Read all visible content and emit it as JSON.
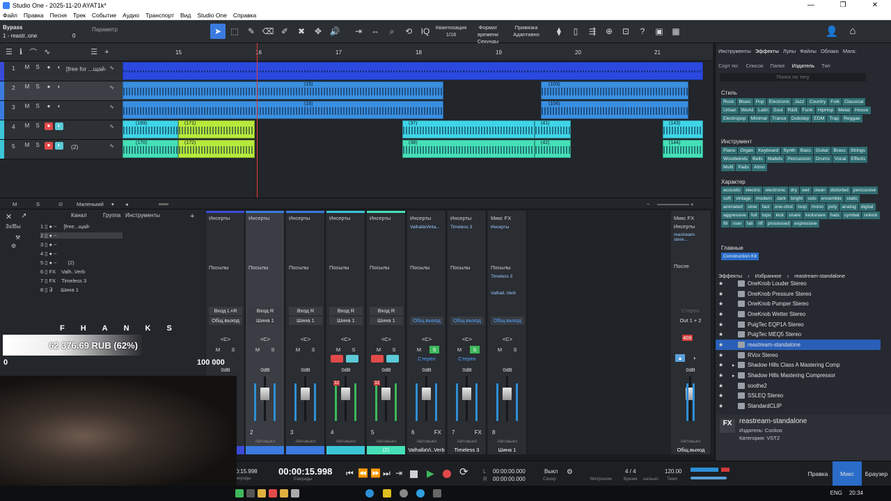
{
  "titlebar": {
    "title": "Studio One - 2025-11-20 AYAT1k*"
  },
  "menu": [
    "Файл",
    "Правка",
    "Песня",
    "Трек",
    "Событие",
    "Аудио",
    "Транспорт",
    "Вид",
    "Studio One",
    "Справка"
  ],
  "toolbar": {
    "bypass": "Bypass",
    "track": "1 - reastr..one",
    "param": "Параметр",
    "zero": "0",
    "quant_label": "Квантизация",
    "quant_value": "1/16",
    "timefmt_label": "Формат времени",
    "timefmt_value": "Секунды",
    "snap_label": "Привязка",
    "snap_value": "Адаптивно"
  },
  "ruler": [
    "15",
    "16",
    "17",
    "18",
    "19",
    "20",
    "21"
  ],
  "tracks": [
    {
      "num": "1",
      "name": "[free for ...щай-",
      "color": "#3a4bd8"
    },
    {
      "num": "2",
      "name": "",
      "color": "#3b7be0"
    },
    {
      "num": "3",
      "name": "",
      "color": "#3b7be0"
    },
    {
      "num": "4",
      "name": "",
      "color": "#3bc6d8"
    },
    {
      "num": "5",
      "name": "(2)",
      "color": "#3bc6d8"
    }
  ],
  "clips": [
    {
      "label": "",
      "color": "#2b49e0"
    },
    {
      "label": "(15)",
      "color": "#3a8fe0"
    },
    {
      "label": "(103)",
      "color": "#3a8fe0"
    },
    {
      "label": "(16)",
      "color": "#3a8fe0"
    },
    {
      "label": "(104)",
      "color": "#3a8fe0"
    },
    {
      "label": "(169)",
      "color": "#3fd5e6"
    },
    {
      "label": "(171)",
      "color": "#b7ea3c"
    },
    {
      "label": "(37)",
      "color": "#3fd5e6"
    },
    {
      "label": "(41)",
      "color": "#3fd5e6"
    },
    {
      "label": "(143)",
      "color": "#3fd5e6"
    },
    {
      "label": "(170)",
      "color": "#45e0b8"
    },
    {
      "label": "(172)",
      "color": "#b7ea3c"
    },
    {
      "label": "(38)",
      "color": "#45e0b8"
    },
    {
      "label": "(42)",
      "color": "#45e0b8"
    },
    {
      "label": "(144)",
      "color": "#45e0b8"
    }
  ],
  "arr_bottom": {
    "m": "M",
    "s": "S",
    "size": "Маленький"
  },
  "mixer_side": {
    "channel": "Канал",
    "group": "Группа",
    "instruments": "Инструменты",
    "mode": "3х/Вы",
    "channels": [
      {
        "num": "1",
        "name": "[free...щай-"
      },
      {
        "num": "2",
        "name": ""
      },
      {
        "num": "3",
        "name": ""
      },
      {
        "num": "4",
        "name": ""
      },
      {
        "num": "5",
        "name": "(2)"
      },
      {
        "num": "6",
        "name": "Valh..Verb"
      },
      {
        "num": "7",
        "name": "Timeless 3"
      },
      {
        "num": "8",
        "name": "Шина 1"
      }
    ]
  },
  "strips": [
    {
      "ins": "Инсерты",
      "ins_plug": "",
      "send": "Посылы",
      "in": "Вход L+R",
      "out": "Общ.выход",
      "db": "0dB",
      "num": "",
      "label": "...щай-",
      "labelColor": "#3a4bd8",
      "topColor": "#3a4bd8",
      "kind": "audio",
      "peak": ""
    },
    {
      "ins": "Инсерты",
      "ins_plug": "",
      "send": "Посылы",
      "in": "Вход R",
      "out": "Шина 1",
      "db": "0dB",
      "num": "2",
      "label": "",
      "labelColor": "#3b7be0",
      "topColor": "#3b7be0",
      "kind": "audio",
      "peak": ""
    },
    {
      "ins": "Инсерты",
      "ins_plug": "",
      "send": "Посылы",
      "in": "Вход R",
      "out": "Шина 1",
      "db": "0dB",
      "num": "3",
      "label": "",
      "labelColor": "#3b7be0",
      "topColor": "#3b7be0",
      "kind": "audio",
      "peak": ""
    },
    {
      "ins": "Инсерты",
      "ins_plug": "",
      "send": "Посылы",
      "in": "Вход R",
      "out": "Шина 1",
      "db": "0dB",
      "num": "4",
      "label": "",
      "labelColor": "#3bc6d8",
      "topColor": "#3bc6d8",
      "kind": "rec",
      "peak": "32"
    },
    {
      "ins": "Инсерты",
      "ins_plug": "",
      "send": "Посылы",
      "in": "Вход R",
      "out": "Шина 1",
      "db": "0dB",
      "num": "5",
      "label": "(2)",
      "labelColor": "#45e0b8",
      "topColor": "#45e0b8",
      "kind": "rec",
      "peak": "32"
    },
    {
      "ins": "Инсерты",
      "ins_plug": "ValhallaVinta...",
      "send": "Посылы",
      "in": "",
      "out": "Общ.выход",
      "db": "0dB",
      "num": "6",
      "label": "ValhallaVi..Verb",
      "labelColor": "#2a2d32",
      "topColor": "#2a2d32",
      "kind": "fx",
      "peak": ""
    },
    {
      "ins": "Инсерты",
      "ins_plug": "Timeless 3",
      "send": "Посылы",
      "in": "",
      "out": "Общ.выход",
      "db": "0dB",
      "num": "7",
      "label": "Timeless 3",
      "labelColor": "#2a2d32",
      "topColor": "#2a2d32",
      "kind": "fx",
      "peak": ""
    },
    {
      "ins": "Микс FX",
      "ins_plug": "Инсерты",
      "send": "Посылы",
      "in": "",
      "out": "Общ.выход",
      "db": "0dB",
      "num": "8",
      "label": "Шина 1",
      "labelColor": "#2a2d32",
      "topColor": "#2a2d32",
      "kind": "bus",
      "peak": ""
    }
  ],
  "strip_common": {
    "pan": "<C>",
    "m": "M",
    "s": "S",
    "stereo": "Стерео",
    "auto": "Автовыкл",
    "fx": "FX"
  },
  "sends_bus": [
    "Timeless 3",
    "Valhall..Verb"
  ],
  "master": {
    "mixfx": "Микс FX",
    "ins": "Инсерты",
    "plug": "reastream-stere...",
    "post": "После",
    "stereo": "Стерео",
    "out": "Out 1 + 2",
    "peak": "409",
    "db": "0dB",
    "auto": "Автовыкл",
    "label": "Общ.выход"
  },
  "browser": {
    "tabs": [
      "Инструменты",
      "Эффекты",
      "Лупы",
      "Файлы",
      "Облако",
      "Мага:"
    ],
    "active_tab": "Эффекты",
    "sort_label": "Сорт по:",
    "sort_opts": [
      "Список",
      "Папке",
      "Издатель",
      "Тип"
    ],
    "search_placeholder": "Поиск по тегу",
    "style_title": "Стиль",
    "style": [
      "Rock",
      "Blues",
      "Pop",
      "Electronic",
      "Jazz",
      "Country",
      "Folk",
      "Classical",
      "Urban",
      "World",
      "Latin",
      "Soul",
      "R&B",
      "Funk",
      "HipHop",
      "Metal",
      "House",
      "Electropop",
      "Minimal",
      "Trance",
      "Dubstep",
      "EDM",
      "Trap",
      "Reggae"
    ],
    "instr_title": "Инструмент",
    "instr": [
      "Piano",
      "Organ",
      "Keyboard",
      "Synth",
      "Bass",
      "Guitar",
      "Brass",
      "Strings",
      "Woodwinds",
      "Bells",
      "Mallets",
      "Percussion",
      "Drums",
      "Vocal",
      "Effects",
      "Multi",
      "Pads",
      "Atmo"
    ],
    "char_title": "Характер",
    "character": [
      "acoustic",
      "electric",
      "electronic",
      "dry",
      "wet",
      "clean",
      "distorted",
      "percussive",
      "soft",
      "vintage",
      "modern",
      "dark",
      "bright",
      "solo",
      "ensemble",
      "static",
      "animated",
      "slow",
      "fast",
      "one-shot",
      "loop",
      "mono",
      "poly",
      "analog",
      "digital",
      "aggressive",
      "full",
      "tops",
      "kick",
      "snare",
      "kicksnare",
      "hats",
      "cymbal",
      "nokick",
      "fill",
      "riser",
      "fall",
      "riff",
      "processed",
      "expressive"
    ],
    "main_title": "Главные",
    "main": [
      "Construction Kit"
    ],
    "crumb": [
      "Эффекты",
      "Избранное",
      "reastream-standalone"
    ],
    "plugins": [
      "OneKnob Louder Stereo",
      "OneKnob Pressure Stereo",
      "OneKnob Pumper Stereo",
      "OneKnob Wetter Stereo",
      "PuigTec EQP1A Stereo",
      "PuigTec MEQ5 Stereo",
      "reastream-standalone",
      "RVox Stereo",
      "Shadow Hills Class A Mastering Comp",
      "Shadow Hills Mastering Compressor",
      "soothe2",
      "SSLEQ Stereo",
      "StandardCLIP"
    ],
    "selected_plugin": "reastream-standalone",
    "detail": {
      "badge": "FX",
      "name": "reastream-standalone",
      "vendor": "Издатель:   Cockos",
      "category": "Категория:  VST2"
    }
  },
  "transport": {
    "time_small": "00:15.998",
    "time_small_unit": "Секунды",
    "time_main": "00:00:15.998",
    "time_main_unit": "Секунды",
    "loop_l": "00:00:00.000",
    "loop_r": "00:00:00.000",
    "out": "Выкл",
    "sync": "Синхр",
    "metronome": "Метроном",
    "sig": "4 / 4",
    "sig_label": "Время",
    "tempo": "120.00",
    "tempo_label": "Темп",
    "nal": "нально"
  },
  "modes": [
    "Правка",
    "Микс",
    "Браузер"
  ],
  "active_mode": "Микс",
  "taskbar": {
    "lang": "ENG",
    "clock": "20:34"
  },
  "overlay": {
    "thanks": "FHANKS",
    "amount": "62 376.69 RUB (62%)",
    "goal_min": "0",
    "goal_max": "100 000"
  }
}
